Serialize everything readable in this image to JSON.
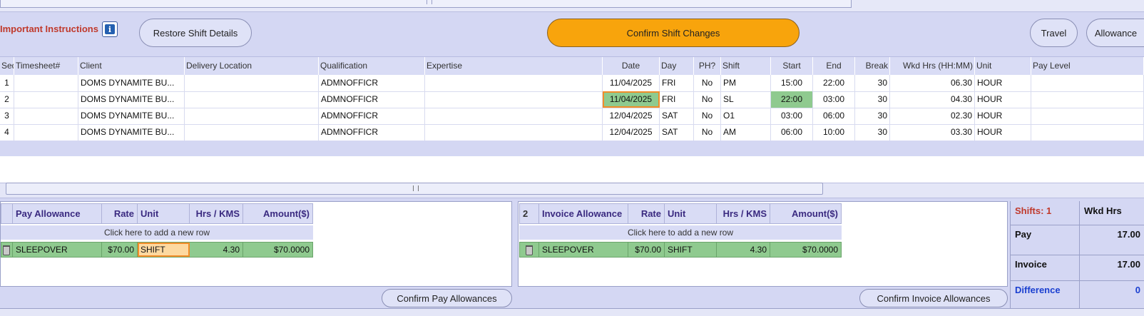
{
  "toolbar": {
    "important_label": "Important Instructions",
    "info_glyph": "i",
    "restore_label": "Restore Shift Details",
    "confirm_shift_label": "Confirm Shift Changes",
    "travel_label": "Travel",
    "allowance_label": "Allowance"
  },
  "grid": {
    "headers": [
      "Seq",
      "Timesheet#",
      "Client",
      "Delivery Location",
      "Qualification",
      "Expertise",
      "Date",
      "Day",
      "PH?",
      "Shift",
      "Start",
      "End",
      "Break",
      "Wkd Hrs (HH:MM)",
      "Unit",
      "Pay Level"
    ],
    "rows": [
      {
        "seq": "1",
        "timesheet": "",
        "client": "DOMS  DYNAMITE  BU...",
        "delivery": "",
        "qual": "ADMNOFFICR",
        "expertise": "",
        "date": "11/04/2025",
        "day": "FRI",
        "ph": "No",
        "shift": "PM",
        "start": "15:00",
        "end": "22:00",
        "break": "30",
        "wkd": "06.30",
        "unit": "HOUR",
        "paylevel": ""
      },
      {
        "seq": "2",
        "timesheet": "",
        "client": "DOMS  DYNAMITE  BU...",
        "delivery": "",
        "qual": "ADMNOFFICR",
        "expertise": "",
        "date": "11/04/2025",
        "day": "FRI",
        "ph": "No",
        "shift": "SL",
        "start": "22:00",
        "end": "03:00",
        "break": "30",
        "wkd": "04.30",
        "unit": "HOUR",
        "paylevel": ""
      },
      {
        "seq": "3",
        "timesheet": "",
        "client": "DOMS  DYNAMITE  BU...",
        "delivery": "",
        "qual": "ADMNOFFICR",
        "expertise": "",
        "date": "12/04/2025",
        "day": "SAT",
        "ph": "No",
        "shift": "O1",
        "start": "03:00",
        "end": "06:00",
        "break": "30",
        "wkd": "02.30",
        "unit": "HOUR",
        "paylevel": ""
      },
      {
        "seq": "4",
        "timesheet": "",
        "client": "DOMS  DYNAMITE  BU...",
        "delivery": "",
        "qual": "ADMNOFFICR",
        "expertise": "",
        "date": "12/04/2025",
        "day": "SAT",
        "ph": "No",
        "shift": "AM",
        "start": "06:00",
        "end": "10:00",
        "break": "30",
        "wkd": "03.30",
        "unit": "HOUR",
        "paylevel": ""
      }
    ]
  },
  "pay": {
    "headers": [
      "Pay Allowance",
      "Rate",
      "Unit",
      "Hrs / KMS",
      "Amount($)"
    ],
    "add_row": "Click here to add a new row",
    "row": {
      "name": "SLEEPOVER",
      "rate": "$70.00",
      "unit": "SHIFT",
      "hrs": "4.30",
      "amount": "$70.0000"
    },
    "confirm_label": "Confirm Pay Allowances"
  },
  "invoice": {
    "count": "2",
    "headers": [
      "Invoice Allowance",
      "Rate",
      "Unit",
      "Hrs / KMS",
      "Amount($)"
    ],
    "add_row": "Click here to add a new row",
    "row": {
      "name": "SLEEPOVER",
      "rate": "$70.00",
      "unit": "SHIFT",
      "hrs": "4.30",
      "amount": "$70.0000"
    },
    "confirm_label": "Confirm Invoice Allowances"
  },
  "summary": {
    "shifts_label": "Shifts: 1",
    "wkd_hrs_label": "Wkd Hrs",
    "pay_label": "Pay",
    "pay_value": "17.00",
    "invoice_label": "Invoice",
    "invoice_value": "17.00",
    "difference_label": "Difference",
    "difference_value": "0"
  },
  "colors": {
    "accent_orange": "#f8a40c",
    "highlight_green": "#8fca8f",
    "label_red": "#c0392b",
    "label_blue": "#1a3fd0"
  }
}
